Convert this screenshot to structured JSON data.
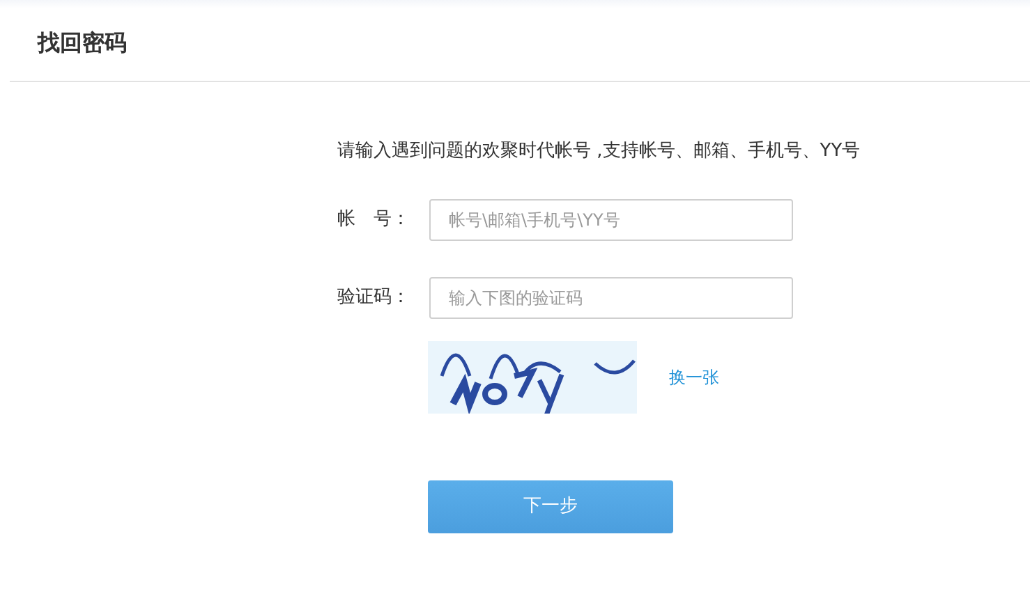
{
  "header": {
    "title": "找回密码"
  },
  "intro": "请输入遇到问题的欢聚时代帐号 ,支持帐号、邮箱、手机号、YY号",
  "fields": [
    {
      "label": "帐　号：",
      "placeholder": "帐号\\邮箱\\手机号\\YY号"
    },
    {
      "label": "验证码：",
      "placeholder": "输入下图的验证码"
    }
  ],
  "captcha": {
    "kind": "picture",
    "refresh_link": "换一张"
  },
  "buttons": [
    "下一步"
  ]
}
